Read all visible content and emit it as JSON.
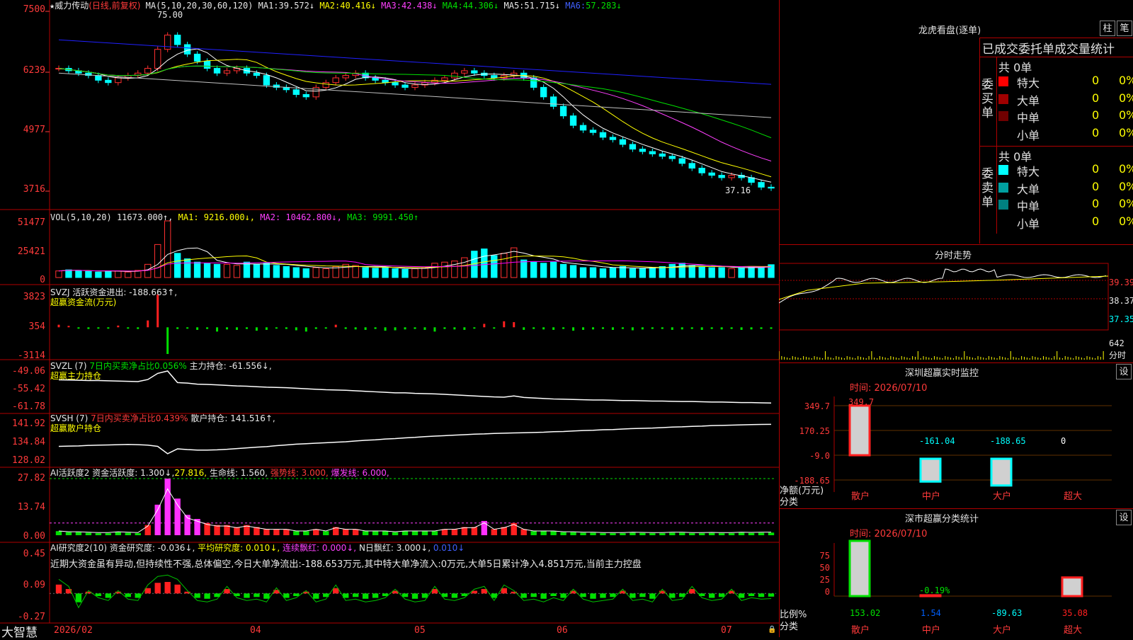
{
  "colors": {
    "up": "#ff3030",
    "down": "#00ffff",
    "bg": "#000000",
    "grid": "#b00000",
    "ma1": "#ffffff",
    "ma2": "#ffff00",
    "ma3": "#ff40ff",
    "ma4": "#00e000",
    "ma5": "#c0c0c0",
    "ma6": "#2020ff"
  },
  "main": {
    "stock_name": "威力传动",
    "mode": "(日线,前复权)",
    "ma_label": "MA(5,10,20,30,60,120)",
    "ma": [
      {
        "k": "MA1:",
        "v": "39.572↓"
      },
      {
        "k": "MA2:",
        "v": "40.416↓"
      },
      {
        "k": "MA3:",
        "v": "42.438↓"
      },
      {
        "k": "MA4:",
        "v": "44.306↓"
      },
      {
        "k": "MA5:",
        "v": "51.715↓"
      },
      {
        "k": "MA6:",
        "v": "57.283↓"
      }
    ],
    "high_label": "75.00",
    "low_label": "37.16",
    "yticks": [
      "7500",
      "6239",
      "4977",
      "3716"
    ]
  },
  "vol": {
    "label": "VOL(5,10,20)",
    "value": "11673.000↑,",
    "ma1": "MA1: 9216.000↓,",
    "ma2": "MA2: 10462.800↓,",
    "ma3": "MA3: 9991.450↑",
    "yticks": [
      "51477",
      "25421",
      "0"
    ]
  },
  "svzj": {
    "label": "SVZJ",
    "t1": "活跃资金进出: -188.663↑,",
    "t2": "超赢资金流(万元)",
    "yticks": [
      "3823",
      "354",
      "-3114"
    ]
  },
  "svzl": {
    "label": "SVZL (7)",
    "t1": "7日内买卖净占比0.056%",
    "t2": "主力持仓: -61.556↓,",
    "t3": "超赢主力持仓",
    "yticks": [
      "-49.06",
      "-55.42",
      "-61.78"
    ]
  },
  "svsh": {
    "label": "SVSH (7)",
    "t1": "7日内买卖净占比0.439%",
    "t2": "散户持仓: 141.516↑,",
    "t3": "超赢散户持仓",
    "yticks": [
      "141.92",
      "134.84",
      "128.02"
    ]
  },
  "ai1": {
    "label": "AI活跃度2",
    "t1": "资金活跃度: 1.300↓,",
    "t2": "27.816,",
    "t3": "生命线: 1.560,",
    "t4": "强势线: 3.000,",
    "t5": "爆发线: 6.000,",
    "yticks": [
      "27.82",
      "13.74",
      "0.00"
    ]
  },
  "ai2": {
    "label": "AI研究度2(10)",
    "t1": "资金研究度: -0.036↓,",
    "t2": "平均研究度: 0.010↓,",
    "t3": "连续飘红: 0.000↓,",
    "t4": "N日飘红: 3.000↓,",
    "t5": "0.010↓",
    "comment": "近期大资金虽有异动,但持续性不强,总体偏空,今日大单净流出:-188.653万元,其中特大单净流入:0万元,大单5日累计净入4.851万元,当前主力控盘",
    "yticks": [
      "0.45",
      "0.09",
      "-0.27"
    ]
  },
  "xaxis": {
    "brand": "大智慧",
    "labels": [
      "2026/02",
      "04",
      "05",
      "06",
      "07"
    ]
  },
  "right": {
    "lhb_title": "龙虎看盘(逐单)",
    "btn1": "柱",
    "btn2": "笔",
    "table_title": "已成交委托单成交量统计",
    "buy_label": "委买单",
    "sell_label": "委卖单",
    "buy_total": "共 0单",
    "sell_total": "共 0单",
    "buy_rows": [
      {
        "name": "特大",
        "v": "0",
        "p": "0%",
        "c": "#ff0000"
      },
      {
        "name": "大单",
        "v": "0",
        "p": "0%",
        "c": "#a00000"
      },
      {
        "name": "中单",
        "v": "0",
        "p": "0%",
        "c": "#700000"
      },
      {
        "name": "小单",
        "v": "0",
        "p": "0%",
        "c": "#000000"
      }
    ],
    "sell_rows": [
      {
        "name": "特大",
        "v": "0",
        "p": "0%",
        "c": "#00ffff"
      },
      {
        "name": "大单",
        "v": "0",
        "p": "0%",
        "c": "#00a0a0"
      },
      {
        "name": "中单",
        "v": "0",
        "p": "0%",
        "c": "#008080"
      },
      {
        "name": "小单",
        "v": "0",
        "p": "0%",
        "c": "#000000"
      }
    ],
    "intraday_title": "分时走势",
    "intraday_yticks": [
      "39.39",
      "38.37",
      "37.35"
    ],
    "intraday_vol": "642",
    "intraday_vol_unit": "分时",
    "sz_title": "深圳超赢实时监控",
    "sz_btn": "设",
    "sz_time": "时间: 2026/07/10",
    "sz_yticks": [
      "349.7",
      "170.25",
      "-9.0",
      "-188.65"
    ],
    "sz_ylabel1": "净额(万元)",
    "sz_ylabel2": "分类",
    "sz_bars": [
      {
        "cat": "散户",
        "v": "349.7"
      },
      {
        "cat": "中户",
        "v": "-161.04"
      },
      {
        "cat": "大户",
        "v": "-188.65"
      },
      {
        "cat": "超大",
        "v": "0"
      }
    ],
    "cls_title": "深市超赢分类统计",
    "cls_btn": "设",
    "cls_time": "时间: 2026/07/10",
    "cls_yticks": [
      "75",
      "50",
      "25",
      "0"
    ],
    "cls_ylabel1": "比例%",
    "cls_ylabel2": "分类",
    "cls_bars": [
      {
        "cat": "散户",
        "v": "153.02"
      },
      {
        "cat": "中户",
        "v": "1.54"
      },
      {
        "cat": "大户",
        "v": "-89.63"
      },
      {
        "cat": "超大",
        "v": "35.08"
      }
    ],
    "cls_extra": "-0.19%"
  },
  "chart_data": [
    {
      "type": "candlestick",
      "title": "威力传动 (日线,前复权)",
      "ylim": [
        3716,
        7500
      ],
      "close": [
        6300,
        6250,
        6200,
        6150,
        6050,
        6000,
        6100,
        6150,
        6200,
        6300,
        6700,
        7000,
        6800,
        6600,
        6450,
        6300,
        6200,
        6250,
        6300,
        6200,
        6150,
        5950,
        5900,
        5850,
        5750,
        5700,
        5900,
        6000,
        6100,
        6150,
        6200,
        6100,
        6050,
        6000,
        5950,
        5900,
        5950,
        6000,
        6050,
        6100,
        6200,
        6250,
        6200,
        6150,
        6100,
        6150,
        6200,
        6100,
        5900,
        5700,
        5500,
        5300,
        5100,
        5000,
        4950,
        4850,
        4800,
        4700,
        4600,
        4550,
        4500,
        4450,
        4400,
        4300,
        4200,
        4100,
        4050,
        4000,
        4050,
        4000,
        3900,
        3800,
        3780
      ]
    },
    {
      "type": "bar",
      "title": "VOL(5,10,20)",
      "ylim": [
        0,
        51477
      ],
      "values": [
        6000,
        7000,
        6500,
        5500,
        5000,
        6000,
        6000,
        5000,
        6500,
        12000,
        30000,
        51477,
        22000,
        17000,
        14000,
        13000,
        12000,
        12000,
        11000,
        14000,
        12000,
        13000,
        11000,
        10000,
        9000,
        8000,
        9000,
        8000,
        10000,
        12000,
        11000,
        9000,
        8500,
        9000,
        8000,
        7500,
        8000,
        9000,
        13000,
        14000,
        15000,
        18000,
        24000,
        26000,
        20000,
        22000,
        27000,
        16000,
        14000,
        13000,
        14000,
        12000,
        11000,
        9000,
        9000,
        8000,
        9000,
        10000,
        8000,
        8000,
        9000,
        10000,
        12000,
        13000,
        11000,
        10000,
        9000,
        9000,
        8000,
        9000,
        10000,
        9500,
        11673
      ]
    },
    {
      "type": "bar",
      "title": "SVZJ 超赢资金流(万元)",
      "ylim": [
        -3114,
        3823
      ],
      "values": [
        300,
        100,
        -150,
        -200,
        -100,
        -150,
        200,
        -100,
        -200,
        800,
        3823,
        -3114,
        -200,
        -150,
        -300,
        -200,
        -500,
        -250,
        -300,
        -200,
        -400,
        -300,
        -150,
        -200,
        -350,
        -500,
        -200,
        -150,
        300,
        -200,
        -250,
        -300,
        -200,
        -400,
        -350,
        -250,
        -200,
        -300,
        -500,
        -200,
        -250,
        -300,
        -100,
        400,
        -150,
        700,
        600,
        -300,
        -200,
        -250,
        -300,
        -200,
        -400,
        -300,
        -250,
        -200,
        -300,
        -200,
        -350,
        -250,
        -200,
        -200,
        -300,
        -250,
        -200,
        -300,
        -200,
        -250,
        -200,
        -300,
        -250,
        -200,
        -188.663
      ]
    },
    {
      "type": "line",
      "title": "SVZL 超赢主力持仓",
      "ylim": [
        -61.78,
        -49.06
      ],
      "values": [
        -52.5,
        -52.6,
        -52.7,
        -52.8,
        -52.8,
        -52.9,
        -53.0,
        -53.1,
        -53.2,
        -52.4,
        -50.0,
        -49.06,
        -53.6,
        -53.8,
        -54.2,
        -54.3,
        -54.5,
        -54.7,
        -54.9,
        -55.0,
        -55.2,
        -55.4,
        -55.5,
        -55.6,
        -55.8,
        -56.0,
        -56.2,
        -56.4,
        -56.5,
        -56.6,
        -56.8,
        -57.0,
        -57.2,
        -57.4,
        -57.6,
        -57.6,
        -57.8,
        -57.9,
        -58.0,
        -58.2,
        -58.4,
        -58.6,
        -58.8,
        -59.0,
        -59.2,
        -59.3,
        -58.8,
        -59.4,
        -59.6,
        -59.8,
        -60.0,
        -60.1,
        -60.2,
        -60.3,
        -60.4,
        -60.4,
        -60.5,
        -60.6,
        -60.6,
        -60.7,
        -60.8,
        -60.8,
        -60.9,
        -61.0,
        -61.0,
        -61.1,
        -61.2,
        -61.2,
        -61.3,
        -61.4,
        -61.4,
        -61.5,
        -61.556
      ]
    },
    {
      "type": "line",
      "title": "SVSH 超赢散户持仓",
      "ylim": [
        128.02,
        141.92
      ],
      "values": [
        132.5,
        132.6,
        132.7,
        132.9,
        133.0,
        133.1,
        133.2,
        133.3,
        133.2,
        133.0,
        132.5,
        129.5,
        131.5,
        131.2,
        131.0,
        131.0,
        131.1,
        131.3,
        131.6,
        131.9,
        132.2,
        132.4,
        132.8,
        133.1,
        133.4,
        133.6,
        133.8,
        134.0,
        134.2,
        134.4,
        134.7,
        135.0,
        135.2,
        135.5,
        135.7,
        136.0,
        136.2,
        136.5,
        136.7,
        136.9,
        137.1,
        137.3,
        137.5,
        137.6,
        137.8,
        137.9,
        138.0,
        138.1,
        138.2,
        138.3,
        138.5,
        138.6,
        138.8,
        139.0,
        139.1,
        139.3,
        139.4,
        139.6,
        139.8,
        139.9,
        140.0,
        140.2,
        140.4,
        140.5,
        140.7,
        140.8,
        141.0,
        141.1,
        141.2,
        141.3,
        141.4,
        141.5,
        141.516
      ]
    },
    {
      "type": "bar",
      "title": "AI活跃度2",
      "ylim": [
        0,
        27.82
      ],
      "values": [
        2,
        1.5,
        1.5,
        1.2,
        1,
        1,
        1.5,
        1.2,
        1,
        5,
        15,
        27.82,
        18,
        10,
        8,
        6,
        5,
        5,
        4,
        5,
        4,
        3,
        3,
        3,
        2,
        2,
        3,
        2,
        4,
        3,
        3,
        2,
        2,
        2,
        1.5,
        2,
        2,
        2,
        2,
        3,
        3,
        4,
        4,
        7,
        3,
        4,
        6,
        3,
        2,
        2,
        2,
        1.5,
        1.5,
        1.2,
        1.2,
        1,
        1,
        1,
        1.2,
        1.1,
        1,
        1,
        1.2,
        1.2,
        1,
        1,
        1.1,
        1,
        1,
        1.2,
        1.1,
        1.2,
        1.3
      ]
    },
    {
      "type": "bar",
      "title": "AI研究度2(10)",
      "ylim": [
        -0.27,
        0.45
      ],
      "values": [
        0.1,
        0.05,
        -0.1,
        0.02,
        -0.03,
        -0.05,
        0.02,
        -0.04,
        -0.05,
        0.06,
        0.12,
        0.13,
        0.1,
        0.02,
        -0.05,
        -0.06,
        -0.04,
        0.05,
        -0.03,
        -0.05,
        -0.04,
        -0.06,
        0.04,
        -0.05,
        -0.03,
        0.02,
        -0.06,
        -0.04,
        0.06,
        -0.05,
        -0.04,
        -0.06,
        -0.05,
        -0.03,
        0.03,
        -0.04,
        -0.06,
        -0.05,
        0.05,
        -0.04,
        -0.05,
        -0.03,
        0.03,
        0.05,
        -0.05,
        0.06,
        0.02,
        -0.05,
        -0.04,
        -0.06,
        -0.03,
        -0.05,
        0.03,
        -0.04,
        -0.06,
        -0.05,
        -0.04,
        0.03,
        -0.05,
        -0.04,
        -0.06,
        0.03,
        -0.05,
        -0.04,
        0.05,
        -0.03,
        -0.05,
        -0.04,
        0.03,
        -0.05,
        -0.03,
        -0.04,
        -0.036
      ]
    }
  ]
}
